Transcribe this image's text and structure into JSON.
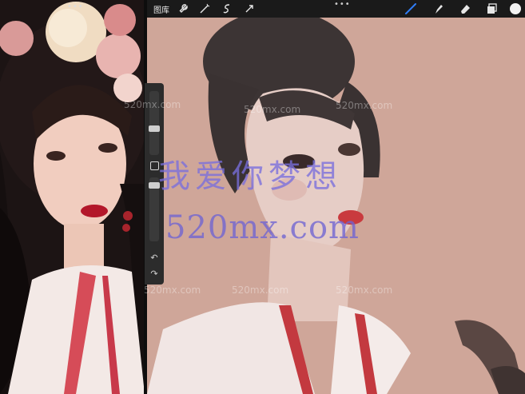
{
  "toolbar": {
    "gallery_label": "图库",
    "handle": "•••",
    "icons": [
      "wrench-icon",
      "magic-wand-icon",
      "selection-icon",
      "transform-arrow-icon",
      "brush-icon",
      "smudge-icon",
      "eraser-icon",
      "layers-icon",
      "color-circle-icon"
    ],
    "active_color": "#f2f2f2",
    "brush_active_color": "#2f7df6"
  },
  "reference": {
    "handle": "•••"
  },
  "watermark": {
    "text": "我爱你梦想",
    "domain": "520mx.com",
    "small": "520mx.com"
  },
  "colors": {
    "canvas_bg": "#cfa699",
    "toolbar_bg": "#1a1a1a",
    "watermark": "#786edc"
  }
}
